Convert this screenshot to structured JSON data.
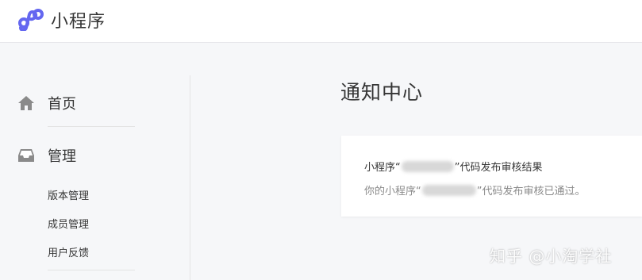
{
  "header": {
    "brand_name": "小程序",
    "logo_color": "#6467f0"
  },
  "sidebar": {
    "items": [
      {
        "label": "首页",
        "icon": "home-icon"
      },
      {
        "label": "管理",
        "icon": "inbox-icon"
      }
    ],
    "sub_items": [
      {
        "label": "版本管理"
      },
      {
        "label": "成员管理"
      },
      {
        "label": "用户反馈"
      }
    ]
  },
  "main": {
    "title": "通知中心",
    "notification": {
      "title_prefix": "小程序“",
      "title_suffix": "”代码发布审核结果",
      "body_prefix": "你的小程序“",
      "body_suffix": "”代码发布审核已通过。"
    }
  },
  "watermark": {
    "text": "知乎 @小淘学社"
  }
}
